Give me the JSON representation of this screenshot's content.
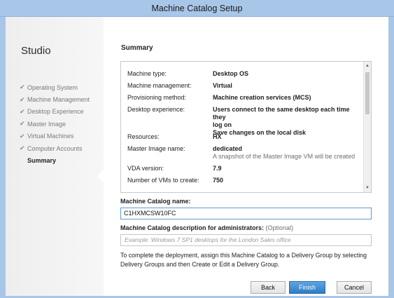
{
  "window": {
    "title": "Machine Catalog Setup"
  },
  "sidebar": {
    "app_name": "Studio",
    "steps": [
      {
        "label": "Operating System",
        "done": true
      },
      {
        "label": "Machine Management",
        "done": true
      },
      {
        "label": "Desktop Experience",
        "done": true
      },
      {
        "label": "Master Image",
        "done": true
      },
      {
        "label": "Virtual Machines",
        "done": true
      },
      {
        "label": "Computer Accounts",
        "done": true
      },
      {
        "label": "Summary",
        "active": true
      }
    ],
    "check_glyph": "✔"
  },
  "summary": {
    "heading": "Summary",
    "rows": [
      {
        "label": "Machine type:",
        "value": "Desktop OS"
      },
      {
        "label": "Machine management:",
        "value": "Virtual"
      },
      {
        "label": "Provisioning method:",
        "value": "Machine creation services (MCS)"
      },
      {
        "label": "Desktop experience:",
        "value_lines": [
          "Users connect to the same desktop each time they",
          "log on",
          "Save changes on the local disk"
        ]
      },
      {
        "label": "Resources:",
        "value": "HX"
      },
      {
        "label": "Master Image name:",
        "value": "dedicated",
        "sub": "A snapshot of the Master Image VM will be created"
      },
      {
        "label": "VDA version:",
        "value": "7.9"
      },
      {
        "label": "Number of VMs to create:",
        "value": "750"
      }
    ]
  },
  "form": {
    "name_label": "Machine Catalog name:",
    "name_value": "C1HXMCSW10FC",
    "desc_label": "Machine Catalog description for administrators:",
    "desc_optional": "(Optional)",
    "desc_placeholder": "Example: Windows 7 SP1 desktops for the London Sales office",
    "instructions": "To complete the deployment, assign this Machine Catalog to a Delivery Group by selecting Delivery Groups and then Create or Edit a Delivery Group."
  },
  "buttons": {
    "back": "Back",
    "finish": "Finish",
    "cancel": "Cancel"
  },
  "colors": {
    "accent": "#2f7bc4",
    "titlebar": "#a8c6e8"
  }
}
